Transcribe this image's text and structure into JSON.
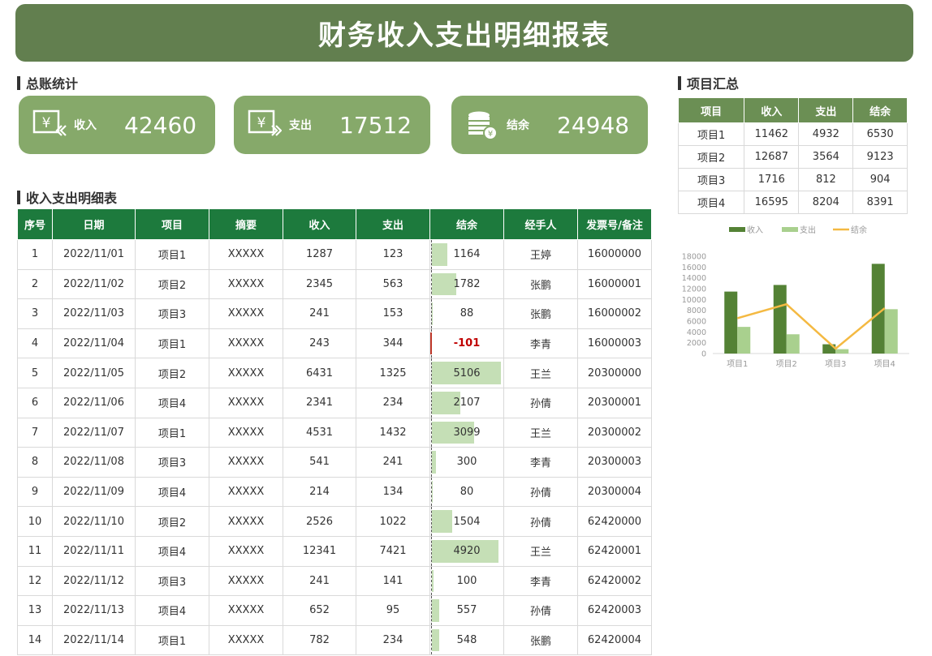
{
  "header": {
    "title": "财务收入支出明细报表"
  },
  "sections": {
    "ledger": "总账统计",
    "detail": "收入支出明细表",
    "project_summary": "项目汇总"
  },
  "cards": [
    {
      "label": "收入",
      "value": "42460",
      "icon": "income-yen-icon"
    },
    {
      "label": "支出",
      "value": "17512",
      "icon": "expense-yen-icon"
    },
    {
      "label": "结余",
      "value": "24948",
      "icon": "coins-stack-icon"
    }
  ],
  "detail_table": {
    "headers": [
      "序号",
      "日期",
      "项目",
      "摘要",
      "收入",
      "支出",
      "结余",
      "经手人",
      "发票号/备注"
    ],
    "rows": [
      [
        "1",
        "2022/11/01",
        "项目1",
        "XXXXX",
        "1287",
        "123",
        "1164",
        "王婷",
        "16000000"
      ],
      [
        "2",
        "2022/11/02",
        "项目2",
        "XXXXX",
        "2345",
        "563",
        "1782",
        "张鹏",
        "16000001"
      ],
      [
        "3",
        "2022/11/03",
        "项目3",
        "XXXXX",
        "241",
        "153",
        "88",
        "张鹏",
        "16000002"
      ],
      [
        "4",
        "2022/11/04",
        "项目1",
        "XXXXX",
        "243",
        "344",
        "-101",
        "李青",
        "16000003"
      ],
      [
        "5",
        "2022/11/05",
        "项目2",
        "XXXXX",
        "6431",
        "1325",
        "5106",
        "王兰",
        "20300000"
      ],
      [
        "6",
        "2022/11/06",
        "项目4",
        "XXXXX",
        "2341",
        "234",
        "2107",
        "孙倩",
        "20300001"
      ],
      [
        "7",
        "2022/11/07",
        "项目1",
        "XXXXX",
        "4531",
        "1432",
        "3099",
        "王兰",
        "20300002"
      ],
      [
        "8",
        "2022/11/08",
        "项目3",
        "XXXXX",
        "541",
        "241",
        "300",
        "李青",
        "20300003"
      ],
      [
        "9",
        "2022/11/09",
        "项目4",
        "XXXXX",
        "214",
        "134",
        "80",
        "孙倩",
        "20300004"
      ],
      [
        "10",
        "2022/11/10",
        "项目2",
        "XXXXX",
        "2526",
        "1022",
        "1504",
        "孙倩",
        "62420000"
      ],
      [
        "11",
        "2022/11/11",
        "项目4",
        "XXXXX",
        "12341",
        "7421",
        "4920",
        "王兰",
        "62420001"
      ],
      [
        "12",
        "2022/11/12",
        "项目3",
        "XXXXX",
        "241",
        "141",
        "100",
        "李青",
        "62420002"
      ],
      [
        "13",
        "2022/11/13",
        "项目4",
        "XXXXX",
        "652",
        "95",
        "557",
        "孙倩",
        "62420003"
      ],
      [
        "14",
        "2022/11/14",
        "项目1",
        "XXXXX",
        "782",
        "234",
        "548",
        "张鹏",
        "62420004"
      ]
    ]
  },
  "summary_table": {
    "headers": [
      "项目",
      "收入",
      "支出",
      "结余"
    ],
    "rows": [
      [
        "项目1",
        "11462",
        "4932",
        "6530"
      ],
      [
        "项目2",
        "12687",
        "3564",
        "9123"
      ],
      [
        "项目3",
        "1716",
        "812",
        "904"
      ],
      [
        "项目4",
        "16595",
        "8204",
        "8391"
      ]
    ]
  },
  "colors": {
    "title_bg": "#627f4f",
    "card_bg": "#86a96a",
    "table_header": "#1d7a3d",
    "summary_header": "#6b8f54",
    "income_bar": "#548235",
    "expense_bar": "#a9d08e",
    "balance_line": "#f4b942",
    "balance_fill": "#c5dfb6",
    "negative": "#c00000"
  },
  "chart_data": {
    "type": "bar",
    "categories": [
      "项目1",
      "项目2",
      "项目3",
      "项目4"
    ],
    "series": [
      {
        "name": "收入",
        "type": "bar",
        "values": [
          11462,
          12687,
          1716,
          16595
        ]
      },
      {
        "name": "支出",
        "type": "bar",
        "values": [
          4932,
          3564,
          812,
          8204
        ]
      },
      {
        "name": "结余",
        "type": "line",
        "values": [
          6530,
          9123,
          904,
          8391
        ]
      }
    ],
    "y_ticks": [
      "0",
      "2000",
      "4000",
      "6000",
      "8000",
      "10000",
      "12000",
      "14000",
      "16000",
      "18000"
    ],
    "ylim": [
      0,
      18000
    ],
    "legend_position": "top",
    "grid": false
  }
}
